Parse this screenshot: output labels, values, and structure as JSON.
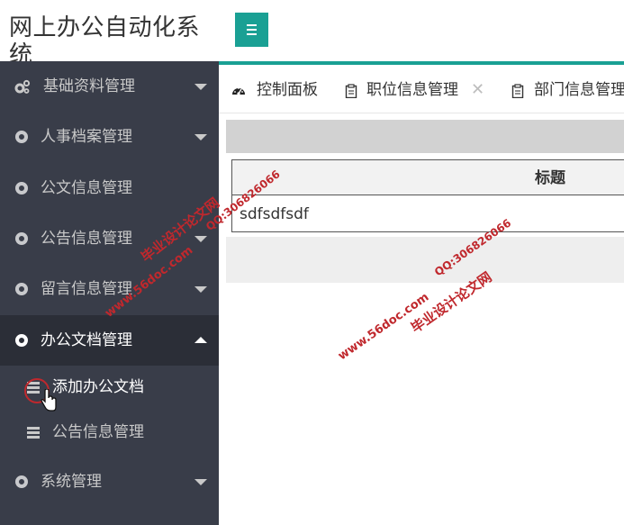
{
  "header": {
    "title": "网上办公自动化系统"
  },
  "sidebar": {
    "items": [
      {
        "label": "基础资料管理",
        "icon": "gears-icon"
      },
      {
        "label": "人事档案管理",
        "icon": "circle-icon"
      },
      {
        "label": "公文信息管理",
        "icon": "circle-icon"
      },
      {
        "label": "公告信息管理",
        "icon": "circle-icon"
      },
      {
        "label": "留言信息管理",
        "icon": "circle-icon"
      },
      {
        "label": "办公文档管理",
        "icon": "circle-icon",
        "expanded": true
      },
      {
        "label": "系统管理",
        "icon": "circle-icon"
      }
    ],
    "subitems": [
      {
        "label": "添加办公文档",
        "icon": "list-icon"
      },
      {
        "label": "公告信息管理",
        "icon": "list-icon"
      }
    ]
  },
  "tabs": [
    {
      "label": "控制面板",
      "icon": "dashboard-icon"
    },
    {
      "label": "职位信息管理",
      "icon": "clipboard-icon",
      "close": "✕"
    },
    {
      "label": "部门信息管理",
      "icon": "clipboard-icon"
    }
  ],
  "table": {
    "columns": [
      "标题"
    ],
    "rows": [
      [
        "sdfsdfsdf"
      ]
    ]
  },
  "watermarks": [
    "毕业设计论文网",
    "QQ:306826066",
    "www.56doc.com"
  ],
  "colors": {
    "accent": "#1aa094",
    "sidebar_bg": "#393d49",
    "sidebar_active": "#2b2e37",
    "watermark": "#c0282d"
  }
}
